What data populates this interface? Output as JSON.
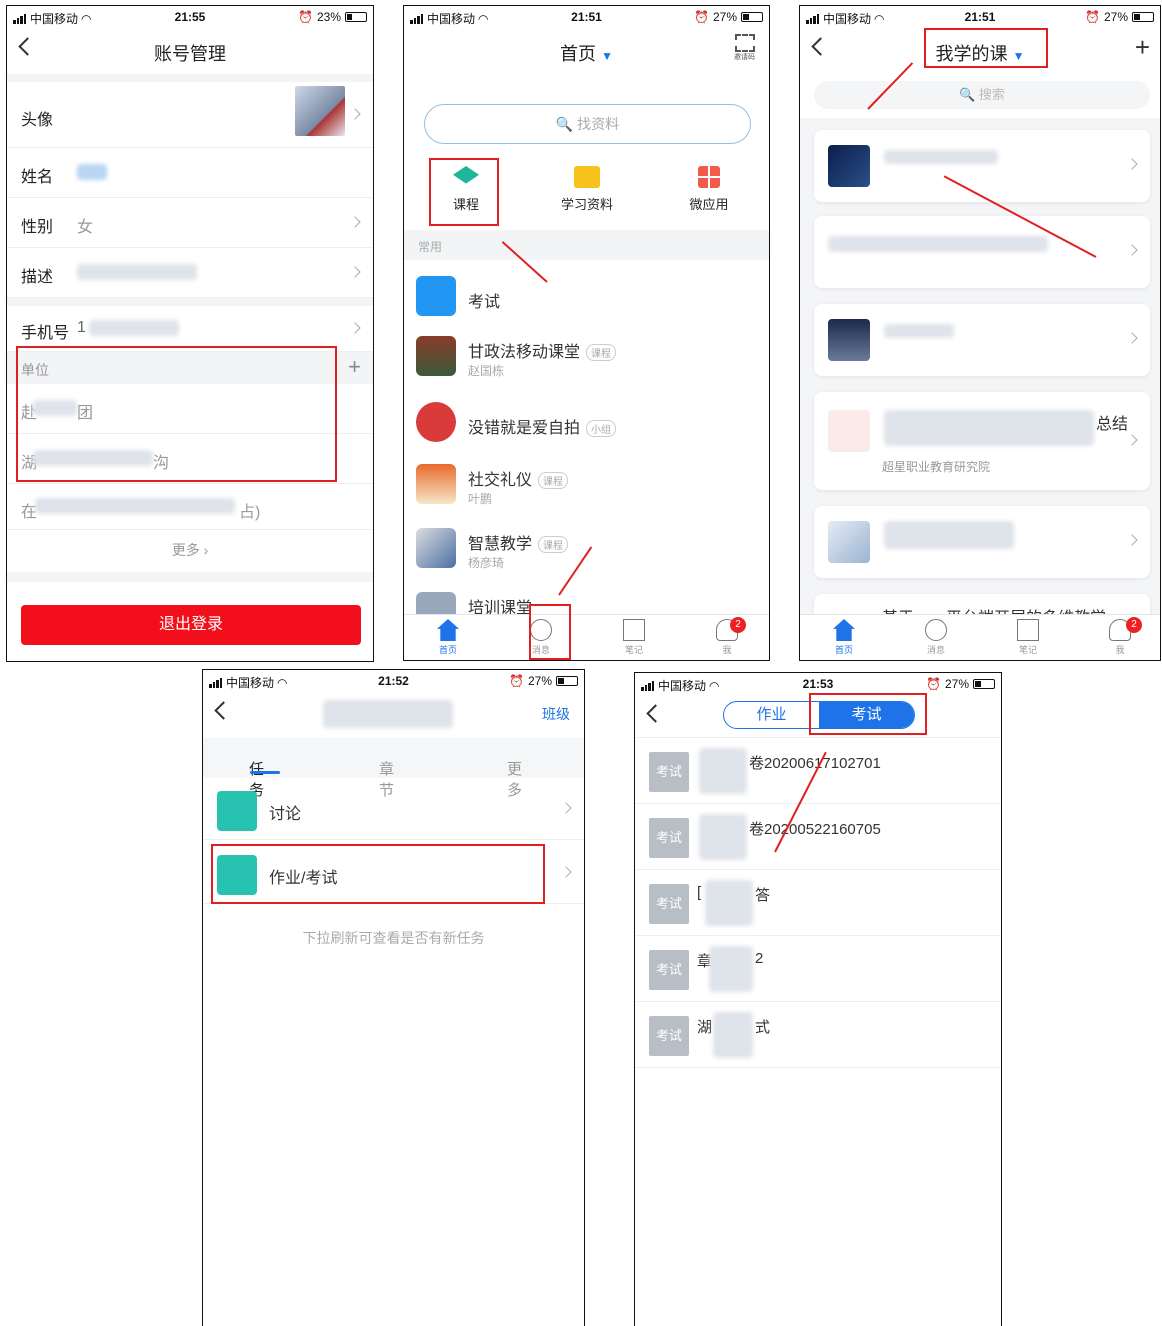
{
  "status_bar": {
    "carrier": "中国移动",
    "p1_time": "21:55",
    "p1_battery": "23%",
    "p2_time": "21:51",
    "p2_battery": "27%",
    "p3_time": "21:51",
    "p3_battery": "27%",
    "p4_time": "21:52",
    "p4_battery": "27%",
    "p5_time": "21:53",
    "p5_battery": "27%"
  },
  "account": {
    "title": "账号管理",
    "avatar_label": "头像",
    "name_label": "姓名",
    "gender_label": "性别",
    "gender_value": "女",
    "desc_label": "描述",
    "phone_label": "手机号",
    "phone_prefix": "1",
    "unit_label": "单位",
    "unit1_start": "赴",
    "unit1_end": "团",
    "unit2_start": "湖",
    "unit2_end": "沟",
    "extra_start": "在",
    "extra_end": "占)",
    "more": "更多",
    "logout": "退出登录"
  },
  "home": {
    "title": "首页",
    "scan_label": "邀请码",
    "search_placeholder": "找资料",
    "quick": [
      "课程",
      "学习资料",
      "微应用"
    ],
    "section": "常用",
    "items": [
      {
        "name": "考试",
        "tag": "",
        "sub": ""
      },
      {
        "name": "甘政法移动课堂",
        "tag": "课程",
        "sub": "赵国栋"
      },
      {
        "name": "没错就是爱自拍",
        "tag": "小组",
        "sub": ""
      },
      {
        "name": "社交礼仪",
        "tag": "课程",
        "sub": "叶鹏"
      },
      {
        "name": "智慧教学",
        "tag": "课程",
        "sub": "杨彦琦"
      },
      {
        "name": "培训课堂",
        "tag": "",
        "sub": ""
      }
    ],
    "tabs": [
      "首页",
      "消息",
      "笔记",
      "我"
    ],
    "badge": "2"
  },
  "courses": {
    "title": "我学的课",
    "search_placeholder": "搜索",
    "card4_suffix": "总结",
    "card4_sub": "超星职业教育研究院",
    "card6_partial": "基于……平台端开展的多维教学",
    "tabs": [
      "首页",
      "消息",
      "笔记",
      "我"
    ],
    "badge": "2"
  },
  "course_detail": {
    "right_link": "班级",
    "tabs": [
      "任务",
      "章节",
      "更多"
    ],
    "tasks": [
      "讨论",
      "作业/考试"
    ],
    "hint": "下拉刷新可查看是否有新任务"
  },
  "exams": {
    "segments": [
      "作业",
      "考试"
    ],
    "tag": "考试",
    "items": [
      {
        "head": "",
        "tail": "卷20200617102701"
      },
      {
        "head": "",
        "tail": "卷20200522160705"
      },
      {
        "head": "[",
        "tail": "答"
      },
      {
        "head": "章",
        "tail": "2"
      },
      {
        "head": "湖",
        "tail": "式"
      }
    ]
  },
  "colors": {
    "accent_blue": "#1e73e8",
    "annotation_red": "#e02020",
    "logout_red": "#f20f1b",
    "task_teal": "#28c3b0"
  }
}
